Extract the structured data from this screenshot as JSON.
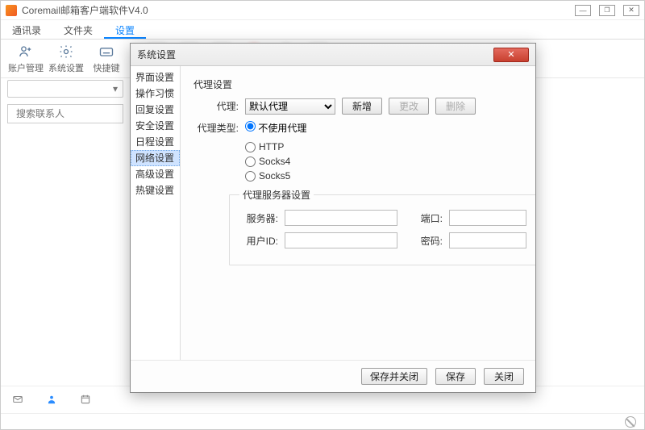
{
  "app": {
    "title": "Coremail邮箱客户端软件V4.0"
  },
  "mainTabs": [
    {
      "label": "通讯录",
      "active": false
    },
    {
      "label": "文件夹",
      "active": false
    },
    {
      "label": "设置",
      "active": true
    }
  ],
  "toolbar": {
    "account_mgmt": "账户管理",
    "system_settings": "系统设置",
    "shortcut_key": "快捷键"
  },
  "search": {
    "placeholder": "搜索联系人"
  },
  "dialog": {
    "title": "系统设置",
    "nav": [
      "界面设置",
      "操作习惯",
      "回复设置",
      "安全设置",
      "日程设置",
      "网络设置",
      "高级设置",
      "热键设置"
    ],
    "nav_selected_index": 5,
    "proxy_section": "代理设置",
    "proxy_label": "代理:",
    "proxy_combo_value": "默认代理",
    "btn_add": "新增",
    "btn_modify": "更改",
    "btn_delete": "删除",
    "proxy_type_label": "代理类型:",
    "proxy_types": [
      "不使用代理",
      "HTTP",
      "Socks4",
      "Socks5"
    ],
    "proxy_type_checked_index": 0,
    "server_group": "代理服务器设置",
    "server_label": "服务器:",
    "port_label": "端口:",
    "userid_label": "用户ID:",
    "password_label": "密码:",
    "footer": {
      "save_close": "保存并关闭",
      "save": "保存",
      "close": "关闭"
    }
  }
}
